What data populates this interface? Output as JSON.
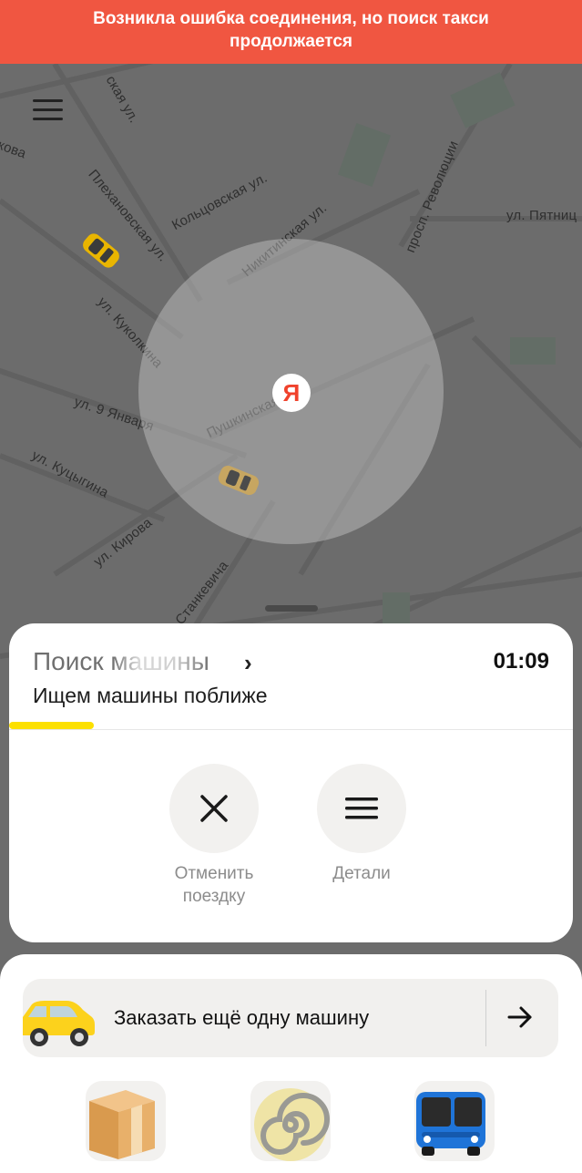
{
  "banner": {
    "line1": "Возникла ошибка соединения, но поиск такси",
    "line2": "продолжается",
    "color": "#f05641"
  },
  "menu": {
    "icon": "hamburger-menu-icon"
  },
  "map": {
    "streets": [
      "ул. Пятниц",
      "Кольцовская ул.",
      "Плехановская ул.",
      "ул. Куколкина",
      "ул. 9 Января",
      "ул. Куцыгина",
      "ул. Кирова",
      "Никитинская ул.",
      "Пушкинская ул.",
      "просп. Революции",
      "кова",
      "ская ул.",
      "Станкевича"
    ],
    "pin_label": "Я"
  },
  "search_card": {
    "title": "Поиск машины",
    "timer": "01:09",
    "subtitle": "Ищем машины поближе",
    "progress_percent": 15,
    "actions": [
      {
        "label_line1": "Отменить",
        "label_line2": "поездку",
        "icon": "close-icon"
      },
      {
        "label_line1": "Детали",
        "label_line2": "",
        "icon": "details-menu-icon"
      }
    ]
  },
  "bottom_sheet": {
    "order_label": "Заказать ещё одну машину",
    "services": [
      "delivery-box-icon",
      "spiral-icon",
      "bus-icon"
    ]
  },
  "colors": {
    "accent": "#fce000",
    "brand_red": "#f0422c"
  }
}
